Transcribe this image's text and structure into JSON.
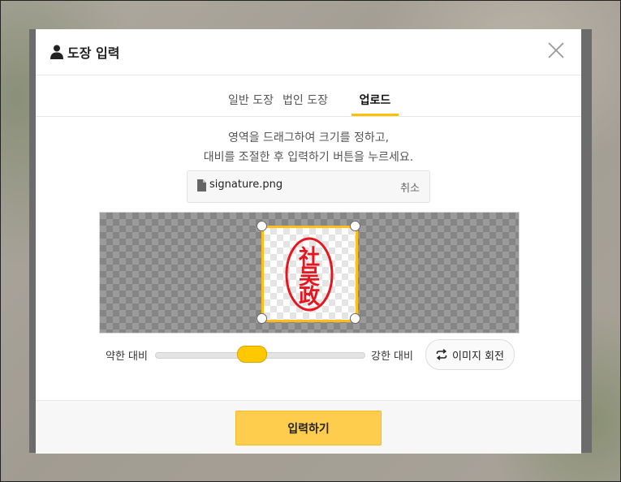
{
  "modal": {
    "title": "도장 입력",
    "title_icon": "person-icon",
    "close_icon": "close-icon"
  },
  "tabs": [
    {
      "label": "일반 도장",
      "active": false
    },
    {
      "label": "법인 도장",
      "active": false
    },
    {
      "label": "업로드",
      "active": true
    }
  ],
  "instructions": {
    "line1": "영역을 드래그하여 크기를 정하고,",
    "line2": "대비를 조절한 후 입력하기 버튼을 누르세요."
  },
  "file": {
    "name": "signature.png",
    "cancel_label": "취소",
    "icon": "file-icon"
  },
  "stamp": {
    "characters": [
      "社",
      "吴",
      "政"
    ],
    "color": "#e8141e"
  },
  "contrast": {
    "weak_label": "약한 대비",
    "strong_label": "강한 대비",
    "value": 0.46
  },
  "rotate": {
    "label": "이미지 회전",
    "icon": "rotate-icon"
  },
  "submit": {
    "label": "입력하기"
  },
  "colors": {
    "accent": "#ffc000",
    "button": "#ffcd4d",
    "stamp_red": "#e8141e"
  }
}
